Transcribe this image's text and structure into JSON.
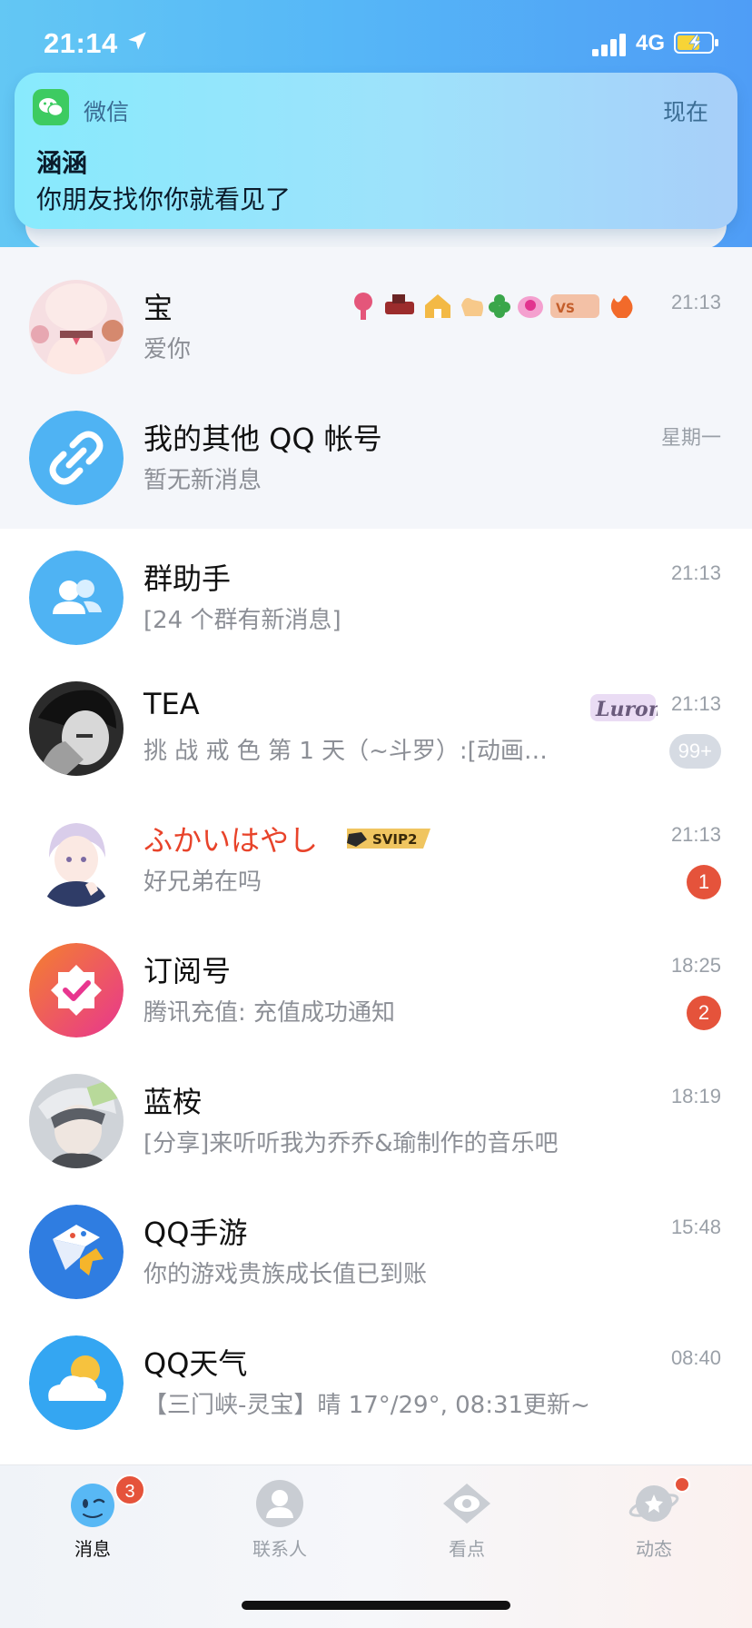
{
  "status_bar": {
    "time": "21:14",
    "network": "4G"
  },
  "notification": {
    "app_name": "微信",
    "when": "现在",
    "title": "涵涵",
    "body": "你朋友找你你就看见了"
  },
  "conversations": [
    {
      "title": "宝",
      "subtitle": "爱你",
      "time": "21:13",
      "pinned": true
    },
    {
      "title": "我的其他 QQ 帐号",
      "subtitle": "暂无新消息",
      "time": "星期一",
      "pinned": true
    },
    {
      "title": "群助手",
      "subtitle": "[24 个群有新消息]",
      "time": "21:13"
    },
    {
      "title": "TEA",
      "subtitle": "挑 战 戒 色 第  1 天（~斗罗）:[动画…",
      "time": "21:13",
      "badge": "99+"
    },
    {
      "title": "ふかいはやし",
      "subtitle": "好兄弟在吗",
      "time": "21:13",
      "badge": "1",
      "vip_label": "SVIP2"
    },
    {
      "title": "订阅号",
      "subtitle": "腾讯充值: 充值成功通知",
      "time": "18:25",
      "badge": "2"
    },
    {
      "title": "蓝桉",
      "subtitle": "[分享]来听听我为乔乔&瑜制作的音乐吧",
      "time": "18:19"
    },
    {
      "title": "QQ手游",
      "subtitle": "你的游戏贵族成长值已到账",
      "time": "15:48"
    },
    {
      "title": "QQ天气",
      "subtitle": "【三门峡-灵宝】晴 17°/29°, 08:31更新~",
      "time": "08:40"
    }
  ],
  "decorations": {
    "luron_label": "Luron"
  },
  "tabbar": {
    "tabs": [
      {
        "label": "消息",
        "badge": "3",
        "active": true
      },
      {
        "label": "联系人"
      },
      {
        "label": "看点"
      },
      {
        "label": "动态",
        "dot": true
      }
    ]
  },
  "colors": {
    "header_gradient_start": "#63c7f4",
    "header_gradient_end": "#4f9df6",
    "badge_red": "#e5533b",
    "accent_blue": "#4fb3f3"
  }
}
